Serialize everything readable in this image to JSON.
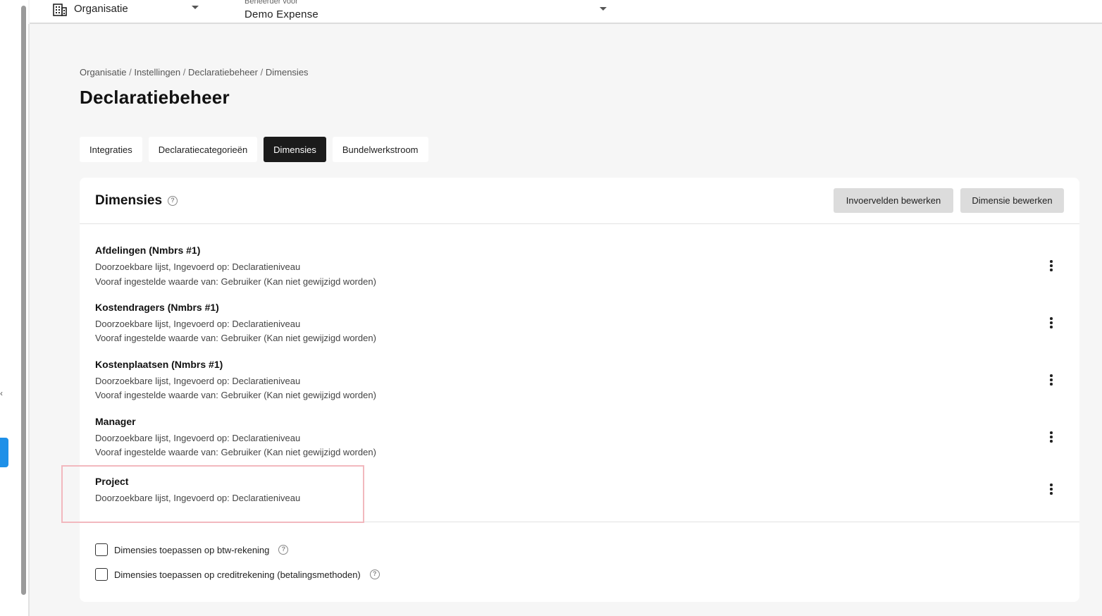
{
  "topbar": {
    "org_label": "Organisatie",
    "admin_caption": "Beheerder voor",
    "admin_value": "Demo Expense"
  },
  "breadcrumb": [
    "Organisatie",
    "Instellingen",
    "Declaratiebeheer",
    "Dimensies"
  ],
  "page_title": "Declaratiebeheer",
  "tabs": [
    {
      "label": "Integraties",
      "active": false
    },
    {
      "label": "Declaratiecategorieën",
      "active": false
    },
    {
      "label": "Dimensies",
      "active": true
    },
    {
      "label": "Bundelwerkstroom",
      "active": false
    }
  ],
  "card": {
    "title": "Dimensies",
    "help_symbol": "?",
    "buttons": {
      "edit_fields": "Invoervelden bewerken",
      "edit_dimension": "Dimensie bewerken"
    },
    "dimensions": [
      {
        "name": "Afdelingen (Nmbrs #1)",
        "line1": "Doorzoekbare lijst, Ingevoerd op: Declaratieniveau",
        "line2": "Vooraf ingestelde waarde van: Gebruiker (Kan niet gewijzigd worden)"
      },
      {
        "name": "Kostendragers (Nmbrs #1)",
        "line1": "Doorzoekbare lijst, Ingevoerd op: Declaratieniveau",
        "line2": "Vooraf ingestelde waarde van: Gebruiker (Kan niet gewijzigd worden)"
      },
      {
        "name": "Kostenplaatsen (Nmbrs #1)",
        "line1": "Doorzoekbare lijst, Ingevoerd op: Declaratieniveau",
        "line2": "Vooraf ingestelde waarde van: Gebruiker (Kan niet gewijzigd worden)"
      },
      {
        "name": "Manager",
        "line1": "Doorzoekbare lijst, Ingevoerd op: Declaratieniveau",
        "line2": "Vooraf ingestelde waarde van: Gebruiker (Kan niet gewijzigd worden)"
      },
      {
        "name": "Project",
        "line1": "Doorzoekbare lijst, Ingevoerd op: Declaratieniveau"
      }
    ],
    "checkboxes": [
      {
        "label": "Dimensies toepassen op btw-rekening",
        "checked": false
      },
      {
        "label": "Dimensies toepassen op creditrekening (betalingsmethoden)",
        "checked": false
      }
    ]
  },
  "colors": {
    "active_tab": "#1b1b1b",
    "side_tab_accent": "#1e90e8",
    "highlight_border": "#f2b8be",
    "grey_button": "#dcdcdc"
  }
}
